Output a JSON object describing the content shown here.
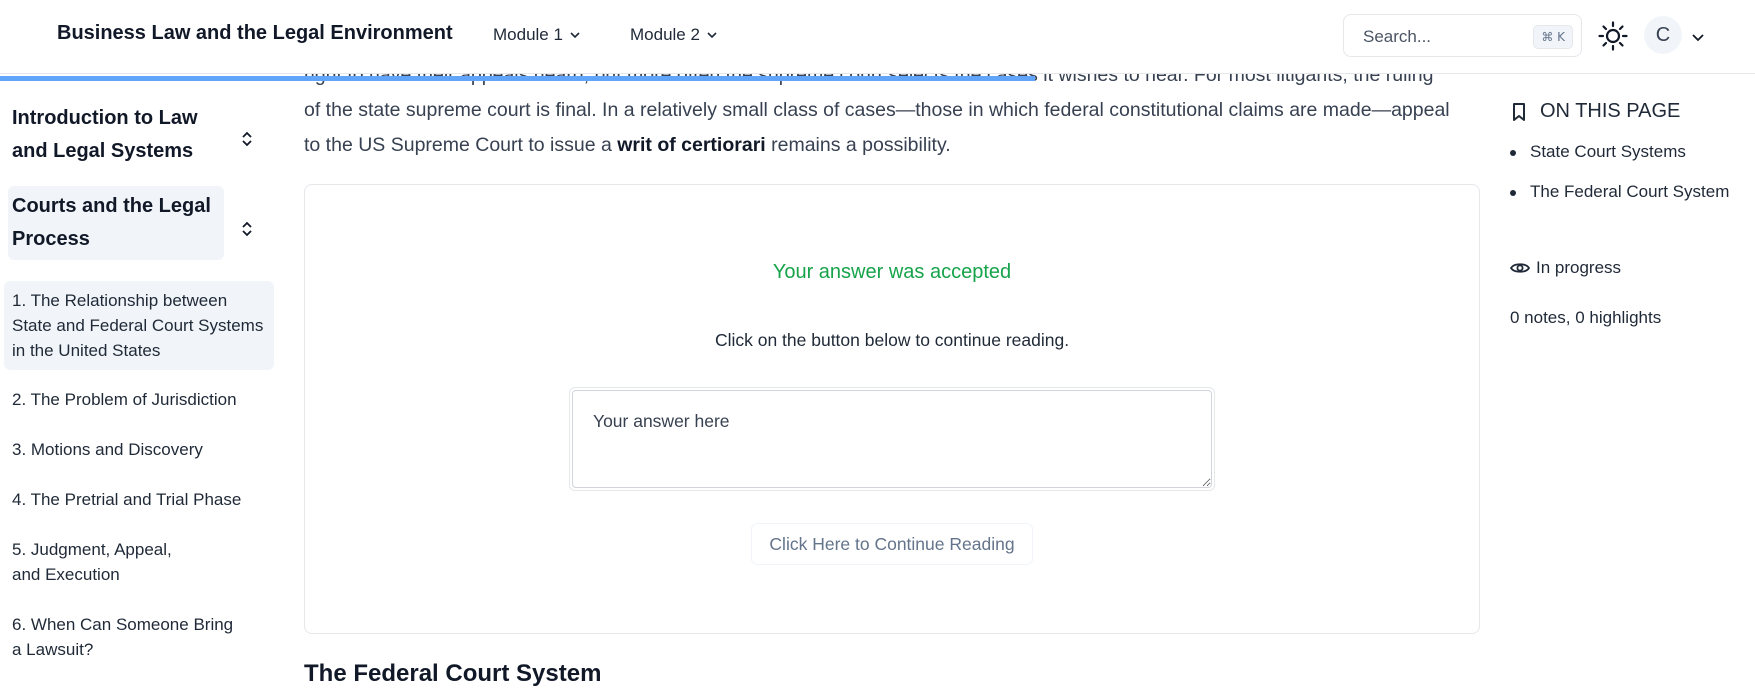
{
  "header": {
    "brand": "Business Law and the Legal Environment",
    "nav": [
      {
        "label": "Module 1"
      },
      {
        "label": "Module 2"
      }
    ],
    "search_placeholder": "Search...",
    "search_shortcut": "⌘ K",
    "avatar_initial": "C"
  },
  "reading_progress": 0.59,
  "sidebar": {
    "sections": [
      {
        "label": "Introduction to Law and Legal Systems"
      },
      {
        "label": "Courts and the Legal Process"
      }
    ],
    "lessons": [
      {
        "label": "1. The Relationship between State and Federal Court Systems in the United States"
      },
      {
        "label": "2. The Problem of Jurisdiction"
      },
      {
        "label": "3. Motions and Discovery"
      },
      {
        "label": "4. The Pretrial and Trial Phase"
      },
      {
        "label": "5. Judgment, Appeal, and Execution"
      },
      {
        "label": "6. When Can Someone Bring a Lawsuit?"
      }
    ]
  },
  "main": {
    "clipped_line": "right to have their appeals heard, but more often the supreme court selects the cases it wishes to hear. For most litigants, the ruling",
    "para_line1": "of the state supreme court is final. In a relatively small class of cases—those in which federal constitutional claims are made—appeal",
    "para_line2_pre": "to the US Supreme Court to issue a ",
    "para_line2_bold": "writ of certiorari",
    "para_line2_post": " remains a possibility.",
    "card": {
      "accepted": "Your answer was accepted",
      "instruction": "Click on the button below to continue reading.",
      "answer_value": "Your answer here",
      "continue_button": "Click Here to Continue Reading"
    },
    "next_heading": "The Federal Court System"
  },
  "toc": {
    "title": "ON THIS PAGE",
    "items": [
      "State Court Systems",
      "The Federal Court System"
    ],
    "status": "In progress",
    "notes": "0 notes, 0 highlights"
  }
}
